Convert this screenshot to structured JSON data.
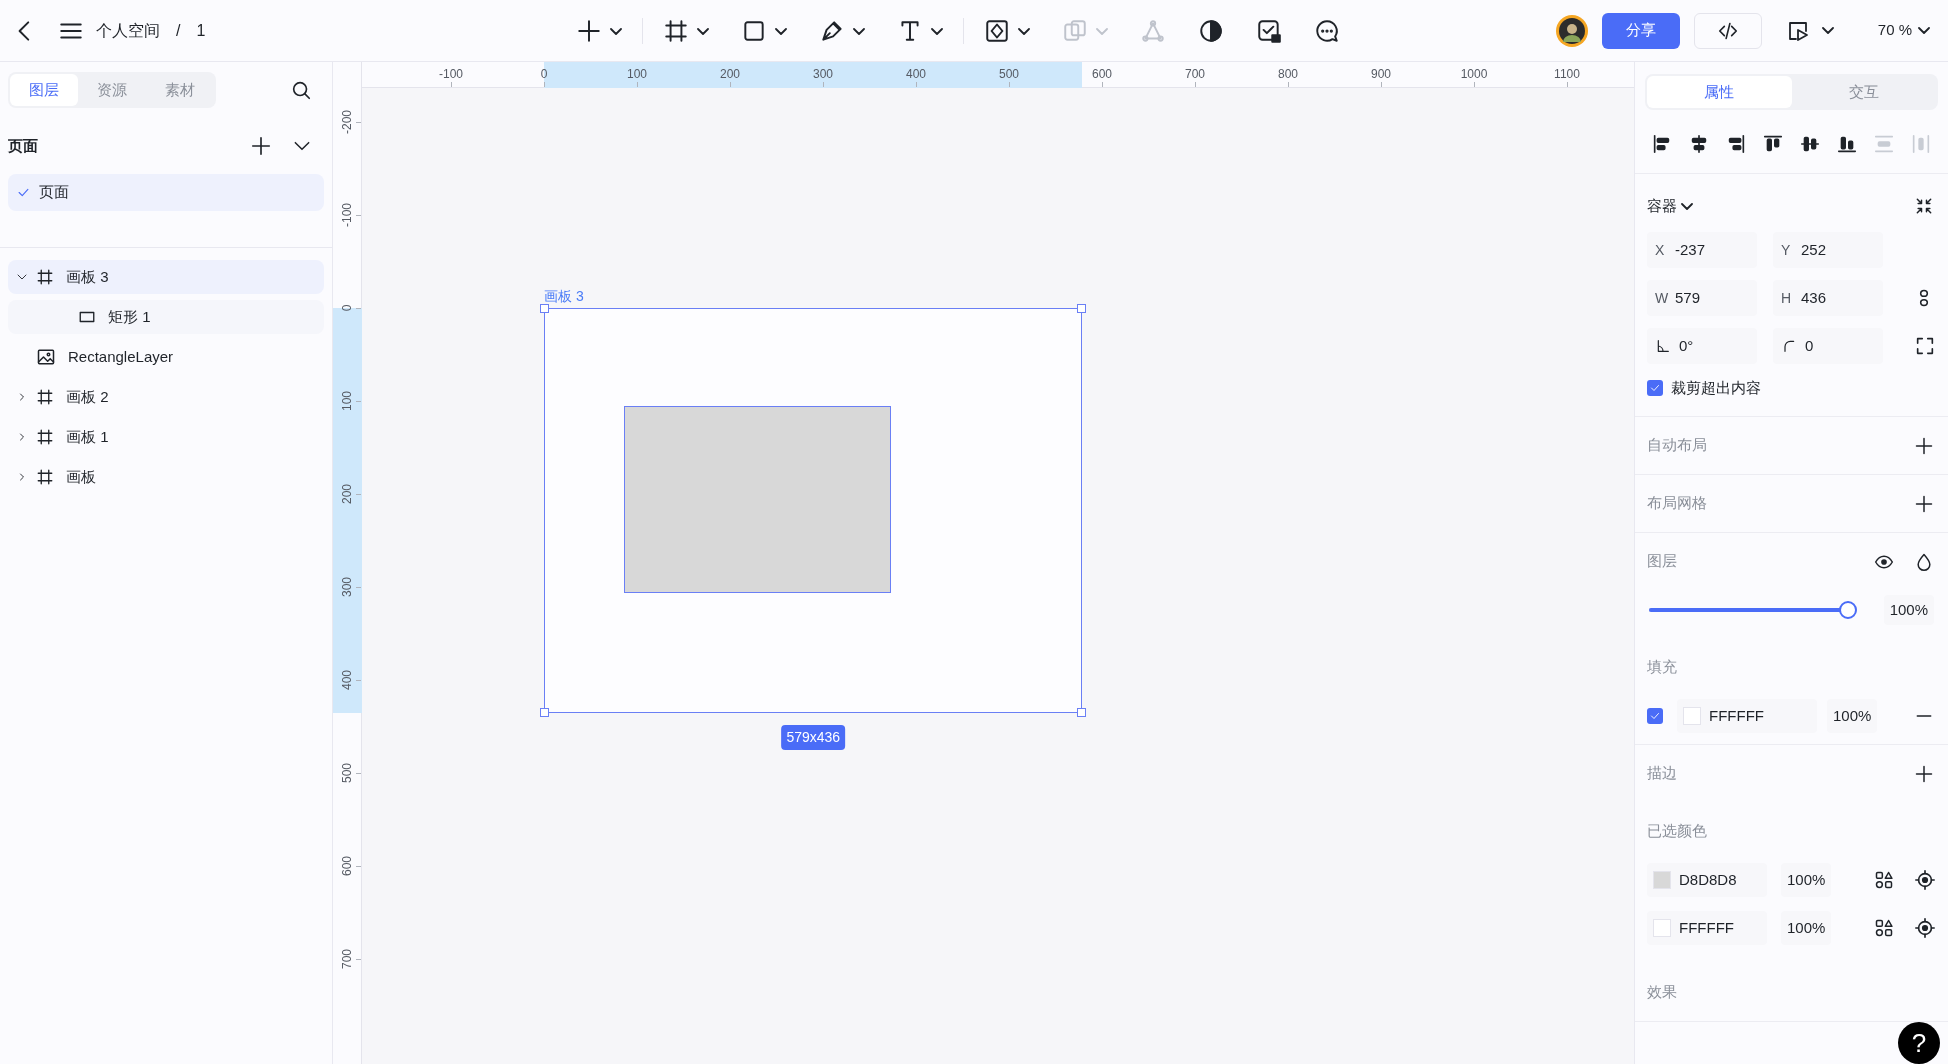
{
  "header": {
    "space": "个人空间",
    "separator": "/",
    "file": "1"
  },
  "toolbar": [
    {
      "kind": "add",
      "dropdown": true,
      "disabled": false
    },
    {
      "kind": "frame",
      "dropdown": true,
      "disabled": false
    },
    {
      "kind": "rect",
      "dropdown": true,
      "disabled": false
    },
    {
      "kind": "pen",
      "dropdown": true,
      "disabled": false
    },
    {
      "kind": "text",
      "dropdown": true,
      "disabled": false
    },
    {
      "kind": "component",
      "dropdown": true,
      "disabled": false
    },
    {
      "kind": "boolean",
      "dropdown": true,
      "disabled": true
    },
    {
      "kind": "vector",
      "dropdown": false,
      "disabled": true
    },
    {
      "kind": "contrast",
      "dropdown": false,
      "disabled": false
    },
    {
      "kind": "check",
      "dropdown": false,
      "disabled": false
    },
    {
      "kind": "comment",
      "dropdown": false,
      "disabled": false
    }
  ],
  "actions": {
    "share": "分享",
    "zoom": "70 %"
  },
  "left_panel": {
    "tabs": [
      {
        "label": "图层",
        "selected": true
      },
      {
        "label": "资源",
        "selected": false
      },
      {
        "label": "素材",
        "selected": false
      }
    ],
    "pages_title": "页面",
    "pages": [
      {
        "label": "页面",
        "selected": true
      }
    ],
    "layers": [
      {
        "label": "画板 3",
        "kind": "frame",
        "expanded": true,
        "selected": true,
        "children": [
          {
            "label": "矩形 1",
            "kind": "rect",
            "selected": false
          }
        ]
      },
      {
        "label": "RectangleLayer",
        "kind": "image",
        "selected": false
      },
      {
        "label": "画板 2",
        "kind": "frame",
        "expanded": false,
        "selected": false
      },
      {
        "label": "画板 1",
        "kind": "frame",
        "expanded": false,
        "selected": false
      },
      {
        "label": "画板",
        "kind": "frame",
        "expanded": false,
        "selected": false
      }
    ]
  },
  "canvas": {
    "hruler": [
      "-100",
      "0",
      "100",
      "200",
      "300",
      "400",
      "500",
      "600",
      "700",
      "800",
      "900",
      "1000",
      "1100"
    ],
    "vruler": [
      "-200",
      "-100",
      "0",
      "100",
      "200",
      "300",
      "400",
      "500",
      "600",
      "700"
    ],
    "artboard": {
      "label": "画板 3",
      "size": "579x436"
    }
  },
  "right_panel": {
    "tabs": [
      {
        "label": "属性",
        "selected": true
      },
      {
        "label": "交互",
        "selected": false
      }
    ],
    "align": [
      {
        "kind": "left",
        "disabled": false
      },
      {
        "kind": "hcenter",
        "disabled": false
      },
      {
        "kind": "right",
        "disabled": false
      },
      {
        "kind": "top",
        "disabled": false
      },
      {
        "kind": "vcenter",
        "disabled": false
      },
      {
        "kind": "bottom",
        "disabled": false
      },
      {
        "kind": "hdist",
        "disabled": true
      },
      {
        "kind": "vdist",
        "disabled": true
      }
    ],
    "container": {
      "title": "容器",
      "fields": [
        {
          "kind": "text",
          "label": "X",
          "value": "-237"
        },
        {
          "kind": "text",
          "label": "Y",
          "value": "252"
        },
        {
          "kind": "text",
          "label": "W",
          "value": "579"
        },
        {
          "kind": "text",
          "label": "H",
          "value": "436"
        },
        {
          "kind": "rotation",
          "value": "0°"
        },
        {
          "kind": "radius",
          "value": "0"
        }
      ]
    },
    "clip": {
      "label": "裁剪超出内容",
      "checked": true
    },
    "auto_layout": "自动布局",
    "layout_grid": "布局网格",
    "layer": {
      "title": "图层",
      "level": 1,
      "opacity": "100%"
    },
    "fill": {
      "title": "填充",
      "items": [
        {
          "checked": true,
          "color": "#ffffff",
          "hex": "FFFFFF",
          "opacity": "100%"
        }
      ]
    },
    "stroke": "描边",
    "selected_colors": {
      "title": "已选颜色",
      "items": [
        {
          "color": "#d8d8d8",
          "hex": "D8D8D8",
          "opacity": "100%"
        },
        {
          "color": "#ffffff",
          "hex": "FFFFFF",
          "opacity": "100%"
        }
      ]
    },
    "effects": "效果"
  },
  "help": "?"
}
